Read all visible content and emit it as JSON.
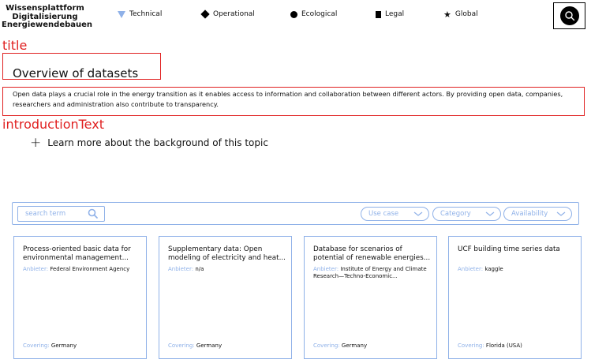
{
  "header": {
    "logo_lines": [
      "Wissensplattform",
      "Digitalisierung",
      "Energiewendebauen"
    ],
    "nav": [
      {
        "label": "Technical",
        "icon": "triangle-down-icon",
        "color": "#8fb1e8"
      },
      {
        "label": "Operational",
        "icon": "diamond-icon",
        "color": "#000000"
      },
      {
        "label": "Ecological",
        "icon": "circle-icon",
        "color": "#000000"
      },
      {
        "label": "Legal",
        "icon": "square-icon",
        "color": "#000000"
      },
      {
        "label": "Global",
        "icon": "star-icon",
        "color": "#000000"
      }
    ],
    "search_icon": "search-icon"
  },
  "annotations": {
    "title_label": "title",
    "intro_label": "introductionText",
    "color": "#e02020"
  },
  "main": {
    "title": "Overview of datasets",
    "intro": "Open data plays a crucial role in the energy transition as it enables access to information and collaboration between different actors. By providing open data, companies, researchers and administration also contribute to transparency.",
    "learn_more": "Learn more about the background of this topic"
  },
  "filters": {
    "search_placeholder": "search term",
    "dropdowns": [
      "Use case",
      "Category",
      "Availability"
    ],
    "accent": "#8fb1e8"
  },
  "cards": [
    {
      "title": "Process-oriented basic data for environmental management...",
      "provider_label": "Anbieter:",
      "provider": "Federal Environment Agency",
      "covering_label": "Covering:",
      "covering": "Germany"
    },
    {
      "title": "Supplementary data: Open modeling of electricity and heat...",
      "provider_label": "Anbieter:",
      "provider": "n/a",
      "covering_label": "Covering:",
      "covering": "Germany"
    },
    {
      "title": "Database for scenarios of potential of renewable energies...",
      "provider_label": "Anbieter:",
      "provider": "Institute of Energy and Climate Research—Techno-Economic...",
      "covering_label": "Covering:",
      "covering": "Germany"
    },
    {
      "title": "UCF building time series data",
      "provider_label": "Anbieter:",
      "provider": "kaggle",
      "covering_label": "Covering:",
      "covering": "Florida (USA)"
    }
  ]
}
